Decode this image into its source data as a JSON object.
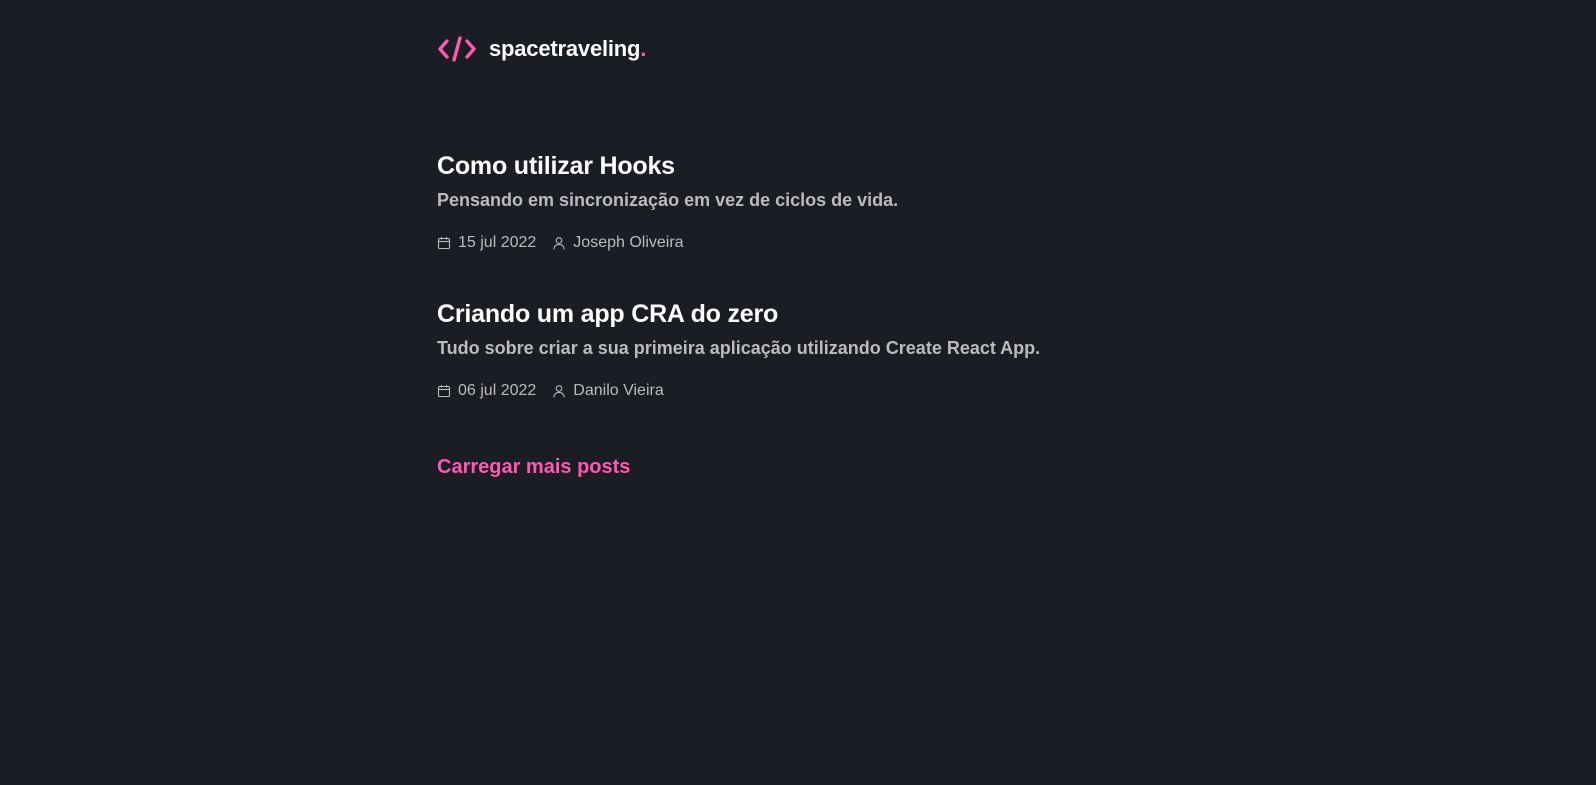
{
  "brand": {
    "name": "spacetraveling",
    "dot": ".",
    "icon": "code-brackets-icon",
    "accent_color": "#ff57b2"
  },
  "posts": [
    {
      "title": "Como utilizar Hooks",
      "subtitle": "Pensando em sincronização em vez de ciclos de vida.",
      "date": "15 jul 2022",
      "author": "Joseph Oliveira"
    },
    {
      "title": "Criando um app CRA do zero",
      "subtitle": "Tudo sobre criar a sua primeira aplicação utilizando Create React App.",
      "date": "06 jul 2022",
      "author": "Danilo Vieira"
    }
  ],
  "load_more_label": "Carregar mais posts",
  "colors": {
    "background": "#1a1d23",
    "heading": "#ffffff",
    "body_text": "#bbbbbb"
  }
}
